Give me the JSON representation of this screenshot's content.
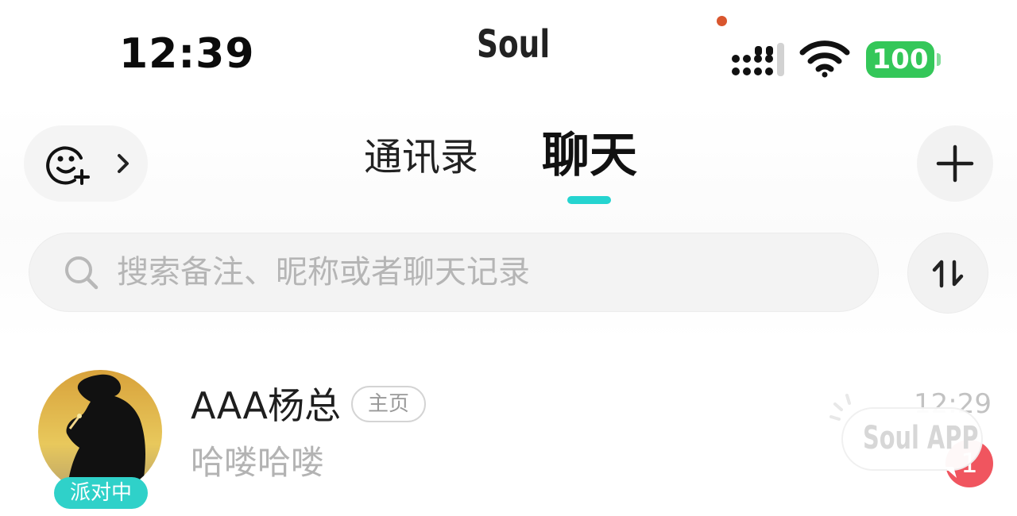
{
  "status_bar": {
    "time": "12:39",
    "app_title": "Soul",
    "battery": "100",
    "icons": [
      "signal-icon",
      "wifi-icon",
      "battery-icon"
    ]
  },
  "nav": {
    "tabs": [
      {
        "label": "通讯录",
        "active": false
      },
      {
        "label": "聊天",
        "active": true
      }
    ],
    "left_icon": "mood-add-icon",
    "right_icon": "plus-icon",
    "accent": "#25d4d0"
  },
  "search": {
    "placeholder": "搜索备注、昵称或者聊天记录",
    "sort_icon": "sort-icon"
  },
  "chats": [
    {
      "name": "AAA杨总",
      "tag": "主页",
      "message": "哈喽哈喽",
      "time": "12:29",
      "status": "派对中",
      "unread": "1"
    }
  ],
  "watermark": "Soul APP"
}
